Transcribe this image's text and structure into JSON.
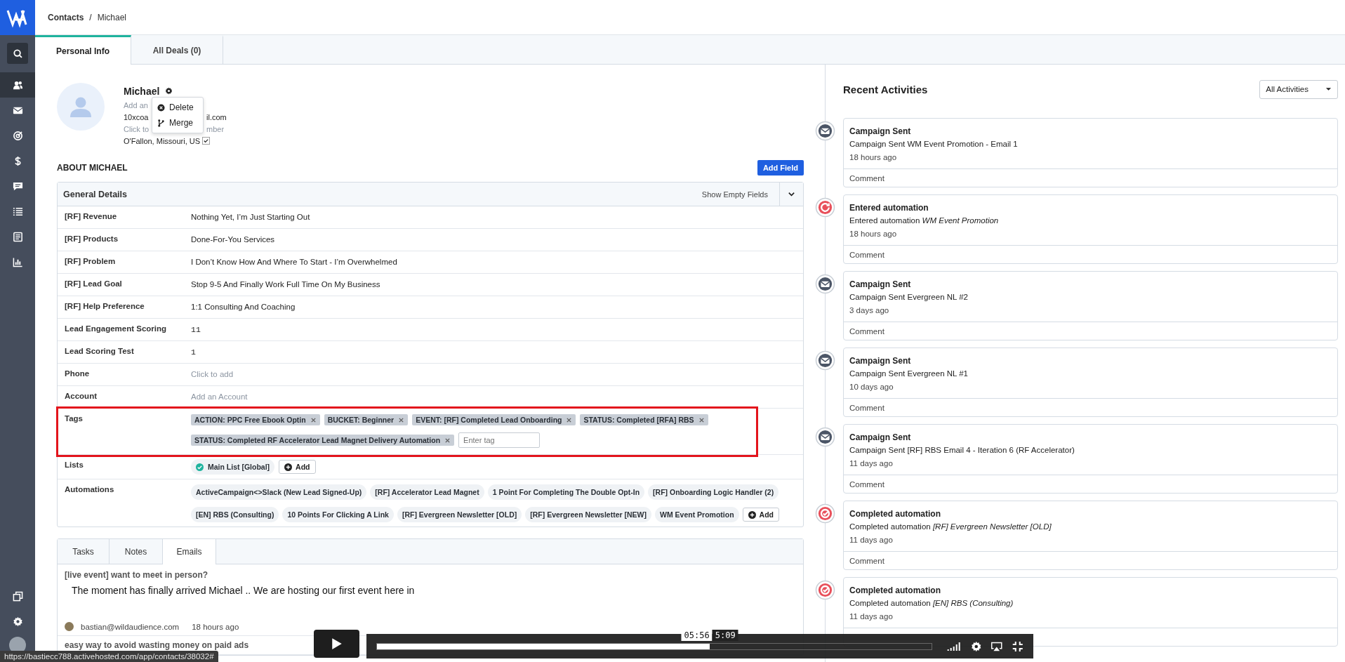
{
  "sidebar": {
    "items": [
      {
        "kind": "search",
        "selected": false
      },
      {
        "kind": "contacts",
        "selected": true
      },
      {
        "kind": "mail",
        "selected": false
      },
      {
        "kind": "target",
        "selected": false
      },
      {
        "kind": "dollar",
        "selected": false
      },
      {
        "kind": "chat",
        "selected": false
      },
      {
        "kind": "list",
        "selected": false
      },
      {
        "kind": "document",
        "selected": false
      },
      {
        "kind": "chart",
        "selected": false
      }
    ],
    "bottom": [
      {
        "kind": "windows"
      },
      {
        "kind": "settings"
      },
      {
        "kind": "avatar"
      }
    ]
  },
  "breadcrumb": {
    "items": [
      "Contacts",
      "Michael"
    ],
    "separator": "/"
  },
  "tabs": [
    {
      "label": "Personal Info",
      "selected": true
    },
    {
      "label": "All Deals (0)",
      "selected": false
    }
  ],
  "contact": {
    "name": "Michael",
    "lines": [
      {
        "kind": "placeholder",
        "parts": [
          "Add an"
        ]
      },
      {
        "kind": "value",
        "parts": [
          "10xcoa",
          "il.com"
        ]
      },
      {
        "kind": "placeholder",
        "parts": [
          "Click to",
          "mber"
        ]
      },
      {
        "kind": "location",
        "parts": [
          "O'Fallon, Missouri, US"
        ]
      }
    ]
  },
  "gear_menu": {
    "items": [
      {
        "kind": "delete",
        "label": "Delete"
      },
      {
        "kind": "merge",
        "label": "Merge"
      }
    ]
  },
  "about": {
    "heading": "ABOUT MICHAEL",
    "add_field": "Add Field"
  },
  "general_details": {
    "title": "General Details",
    "show_empty": "Show Empty Fields",
    "rows": [
      {
        "kind": "text",
        "label": "[RF] Revenue",
        "value": "Nothing Yet, I’m Just Starting Out"
      },
      {
        "kind": "text",
        "label": "[RF] Products",
        "value": "Done-For-You Services"
      },
      {
        "kind": "text",
        "label": "[RF] Problem",
        "value": "I Don’t Know How And Where To Start - I’m Overwhelmed"
      },
      {
        "kind": "text",
        "label": "[RF] Lead Goal",
        "value": "Stop 9-5 And Finally Work Full Time On My Business"
      },
      {
        "kind": "text",
        "label": "[RF] Help Preference",
        "value": "1:1 Consulting And Coaching"
      },
      {
        "kind": "number",
        "label": "Lead Engagement Scoring",
        "value": "11"
      },
      {
        "kind": "number",
        "label": "Lead Scoring Test",
        "value": "1"
      },
      {
        "kind": "placeholder",
        "label": "Phone",
        "value": "Click to add"
      },
      {
        "kind": "placeholder",
        "label": "Account",
        "value": "Add an Account"
      },
      {
        "kind": "tags",
        "label": "Tags",
        "highlighted": true,
        "placeholder": "Enter tag",
        "tags": [
          "ACTION: PPC Free Ebook Optin",
          "BUCKET: Beginner",
          "EVENT: [RF] Completed Lead Onboarding",
          "STATUS: Completed [RFA] RBS",
          "STATUS: Completed RF Accelerator Lead Magnet Delivery Automation"
        ]
      },
      {
        "kind": "lists",
        "label": "Lists",
        "add": "Add",
        "items": [
          {
            "label": "Main List [Global]",
            "subscribed": true
          }
        ]
      },
      {
        "kind": "chips",
        "label": "Automations",
        "add": "Add",
        "items": [
          "ActiveCampaign<>Slack (New Lead Signed-Up)",
          "[RF] Accelerator Lead Magnet",
          "1 Point For Completing The Double Opt-In",
          "[RF] Onboarding Logic Handler (2)",
          "[EN] RBS (Consulting)",
          "10 Points For Clicking A Link",
          "[RF] Evergreen Newsletter [OLD]",
          "[RF] Evergreen Newsletter [NEW]",
          "WM Event Promotion"
        ]
      }
    ]
  },
  "activity_tabs": [
    {
      "label": "Tasks",
      "selected": false
    },
    {
      "label": "Notes",
      "selected": false
    },
    {
      "label": "Emails",
      "selected": true
    }
  ],
  "emails": [
    {
      "subject": "[live event] want to meet in person?",
      "body": "The moment has finally arrived Michael .. We are hosting our first event here in",
      "author": "bastian@wildaudience.com",
      "time": "18 hours ago"
    },
    {
      "subject": "easy way to avoid wasting money on paid ads"
    }
  ],
  "recent_activities": {
    "title": "Recent Activities",
    "filter": "All Activities",
    "items": [
      {
        "kind": "email",
        "title": "Campaign Sent",
        "text": "Campaign Sent WM Event Promotion - Email 1",
        "time": "18 hours ago",
        "comment": "Comment"
      },
      {
        "kind": "automation",
        "title": "Entered automation",
        "text": "Entered automation *WM Event Promotion*",
        "time": "18 hours ago",
        "comment": "Comment"
      },
      {
        "kind": "email",
        "title": "Campaign Sent",
        "text": "Campaign Sent Evergreen NL #2",
        "time": "3 days ago",
        "comment": "Comment"
      },
      {
        "kind": "email",
        "title": "Campaign Sent",
        "text": "Campaign Sent Evergreen NL #1",
        "time": "10 days ago",
        "comment": "Comment"
      },
      {
        "kind": "email",
        "title": "Campaign Sent",
        "text": "Campaign Sent [RF] RBS Email 4 - Iteration 6 (RF Accelerator)",
        "time": "11 days ago",
        "comment": "Comment"
      },
      {
        "kind": "completed",
        "title": "Completed automation",
        "text": "Completed automation *[RF] Evergreen Newsletter [OLD]*",
        "time": "11 days ago",
        "comment": "Comment"
      },
      {
        "kind": "completed",
        "title": "Completed automation",
        "text": "Completed automation *[EN] RBS (Consulting)*",
        "time": "11 days ago"
      }
    ]
  },
  "video_player": {
    "hover_time": "05:56",
    "duration": "5:09",
    "level": 0.6
  },
  "status_url": "https://bastiecc788.activehosted.com/app/contacts/38032#"
}
